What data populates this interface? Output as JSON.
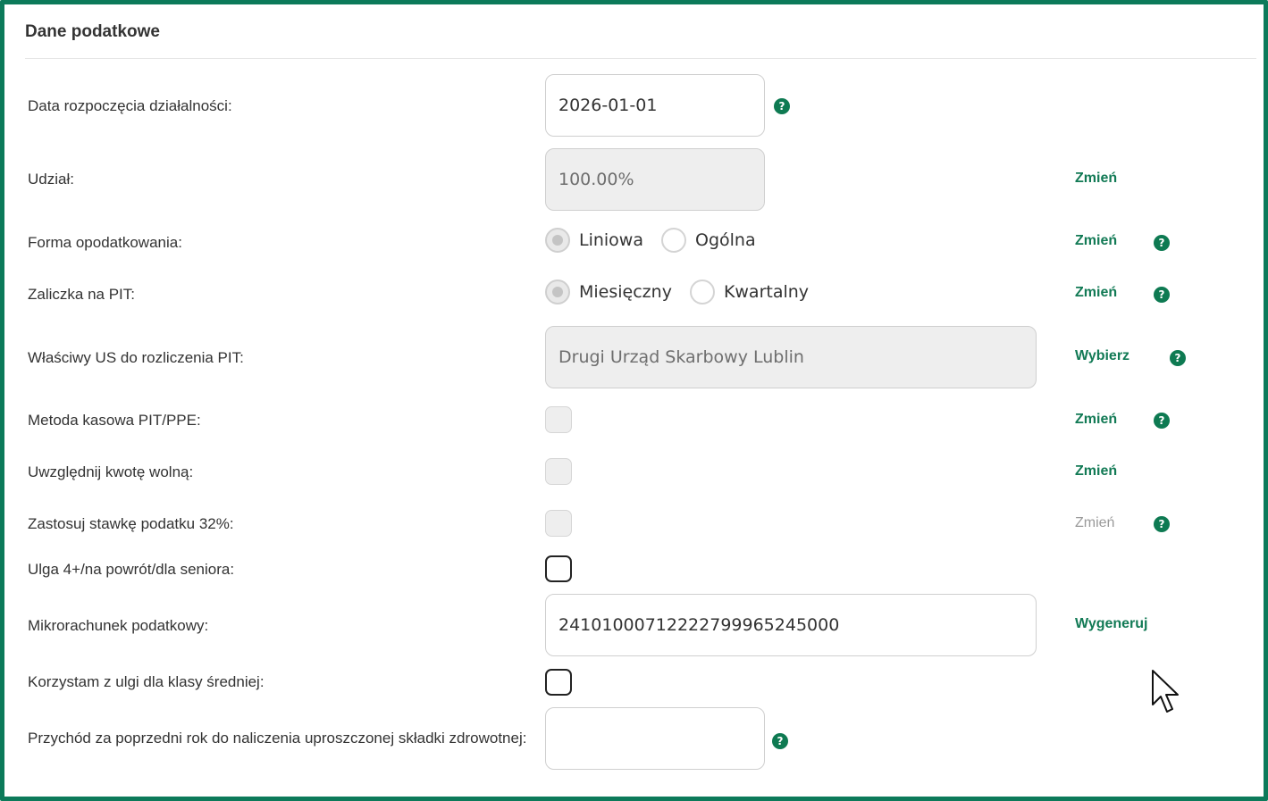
{
  "panel": {
    "title": "Dane podatkowe"
  },
  "rows": {
    "start_date": {
      "label": "Data rozpoczęcia działalności:",
      "value": "2026-01-01"
    },
    "share": {
      "label": "Udział:",
      "value": "100.00%",
      "action": "Zmień"
    },
    "tax_form": {
      "label": "Forma opodatkowania:",
      "options": [
        "Liniowa",
        "Ogólna"
      ],
      "selected": "Liniowa",
      "action": "Zmień"
    },
    "pit_advance": {
      "label": "Zaliczka na PIT:",
      "options": [
        "Miesięczny",
        "Kwartalny"
      ],
      "selected": "Miesięczny",
      "action": "Zmień"
    },
    "tax_office": {
      "label": "Właściwy US do rozliczenia PIT:",
      "value": "Drugi Urząd Skarbowy Lublin",
      "action": "Wybierz"
    },
    "cash_method": {
      "label": "Metoda kasowa PIT/PPE:",
      "checked": false,
      "action": "Zmień"
    },
    "tax_free_amount": {
      "label": "Uwzględnij kwotę wolną:",
      "checked": false,
      "action": "Zmień"
    },
    "rate_32": {
      "label": "Zastosuj stawkę podatku 32%:",
      "checked": false,
      "action": "Zmień"
    },
    "relief_4plus": {
      "label": "Ulga 4+/na powrót/dla seniora:",
      "checked": false
    },
    "micro_account": {
      "label": "Mikrorachunek podatkowy:",
      "value": "24101000712222799965245000",
      "action": "Wygeneruj"
    },
    "middle_class": {
      "label": "Korzystam z ulgi dla klasy średniej:",
      "checked": false
    },
    "prev_revenue": {
      "label": "Przychód za poprzedni rok do naliczenia uproszczonej składki zdrowotnej:",
      "value": ""
    }
  },
  "help_glyph": "?",
  "colors": {
    "frame": "#0c7a5a",
    "accent": "#127a55",
    "help": "#0e7a52",
    "muted": "#9a9a9a"
  },
  "icons": {
    "help": "question-circle-icon",
    "cursor": "mouse-pointer-icon"
  }
}
